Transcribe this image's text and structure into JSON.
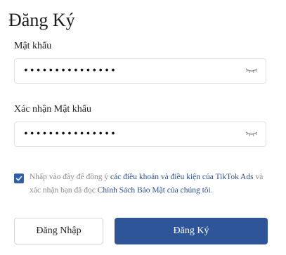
{
  "form": {
    "title": "Đăng Ký",
    "password": {
      "label": "Mật khẩu",
      "value": "•••••••••••••••",
      "icon": "eye-closed-icon"
    },
    "confirm_password": {
      "label": "Xác nhận Mật khẩu",
      "value": "•••••••••••••••",
      "icon": "eye-closed-icon"
    },
    "agreement": {
      "checked": true,
      "text_1": "Nhấp vào đây để đồng ý ",
      "link_1": "các điều khoản và điều kiện của TikTok Ads",
      "text_2": " và xác nhận bạn đã đọc ",
      "link_2": "Chính Sách Bảo Mật của chúng tôi",
      "text_3": "."
    },
    "buttons": {
      "login_label": "Đăng Nhập",
      "register_label": "Đăng Ký"
    }
  },
  "colors": {
    "primary": "#2d5597",
    "link": "#2a4f8c",
    "muted_text": "#8a8a8a",
    "border": "#e3e3e3"
  }
}
